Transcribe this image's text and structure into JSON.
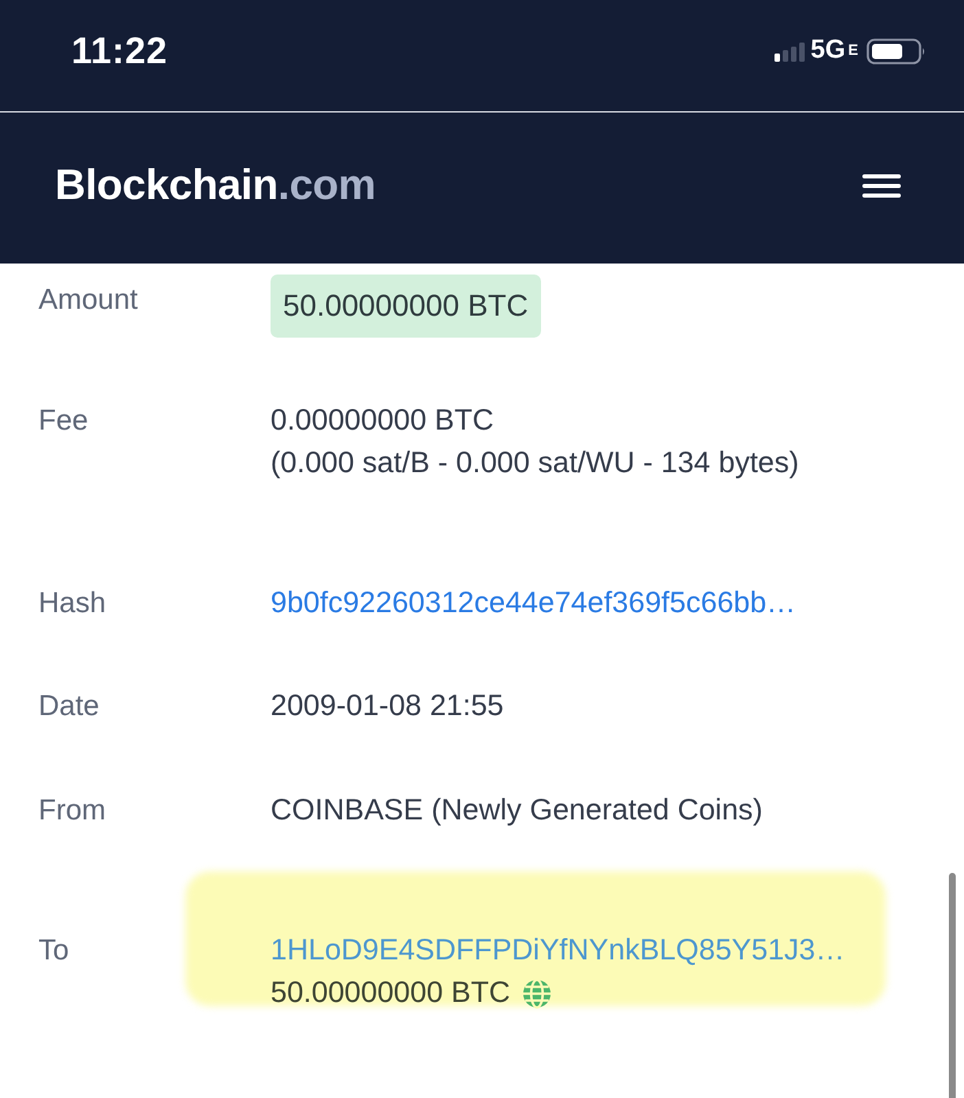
{
  "status_bar": {
    "time": "11:22",
    "network": "5G",
    "network_suffix": "E"
  },
  "header": {
    "logo_name": "Blockchain",
    "logo_suffix": ".com"
  },
  "rows": [
    {
      "label": "Amount",
      "kind": "badge",
      "value": "50.00000000 BTC"
    },
    {
      "label": "Fee",
      "kind": "text",
      "lines": [
        "0.00000000 BTC",
        "(0.000 sat/B - 0.000 sat/WU - 134 bytes)"
      ]
    },
    {
      "label": "Hash",
      "kind": "link",
      "value": "9b0fc92260312ce44e74ef369f5c66bb…"
    },
    {
      "label": "Date",
      "kind": "text",
      "lines": [
        "2009-01-08 21:55"
      ]
    },
    {
      "label": "From",
      "kind": "text",
      "lines": [
        "COINBASE (Newly Generated Coins)"
      ]
    },
    {
      "label": "To",
      "kind": "output",
      "address": "1HLoD9E4SDFFPDiYfNYnkBLQ85Y51J3…",
      "amount": "50.00000000 BTC",
      "highlighted": true
    }
  ]
}
